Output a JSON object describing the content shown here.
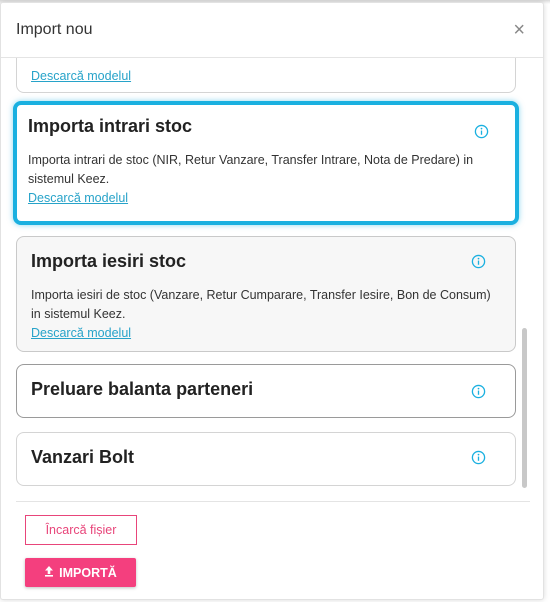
{
  "dialog": {
    "title": "Import nou",
    "close_glyph": "×"
  },
  "cards": [
    {
      "title": "",
      "description": "",
      "link": "Descarcă modelul",
      "state": "partial"
    },
    {
      "title": "Importa intrari stoc",
      "description": "Importa intrari de stoc (NIR, Retur Vanzare, Transfer Intrare, Nota de Predare) in sistemul Keez.",
      "link": "Descarcă modelul",
      "state": "selected"
    },
    {
      "title": "Importa iesiri stoc",
      "description": "Importa iesiri de stoc (Vanzare, Retur Cumparare, Transfer Iesire, Bon de Consum) in sistemul Keez.",
      "link": "Descarcă modelul",
      "state": "hovered"
    },
    {
      "title": "Preluare balanta parteneri",
      "state": "default"
    },
    {
      "title": "Vanzari Bolt",
      "state": "default"
    }
  ],
  "footer": {
    "upload_label": "Încarcă fișier",
    "import_label": "IMPORTĂ",
    "import_icon": "upload-icon"
  },
  "colors": {
    "accent_cyan": "#1ab0e0",
    "brand_pink": "#f43f7e",
    "link": "#27a3c9"
  }
}
